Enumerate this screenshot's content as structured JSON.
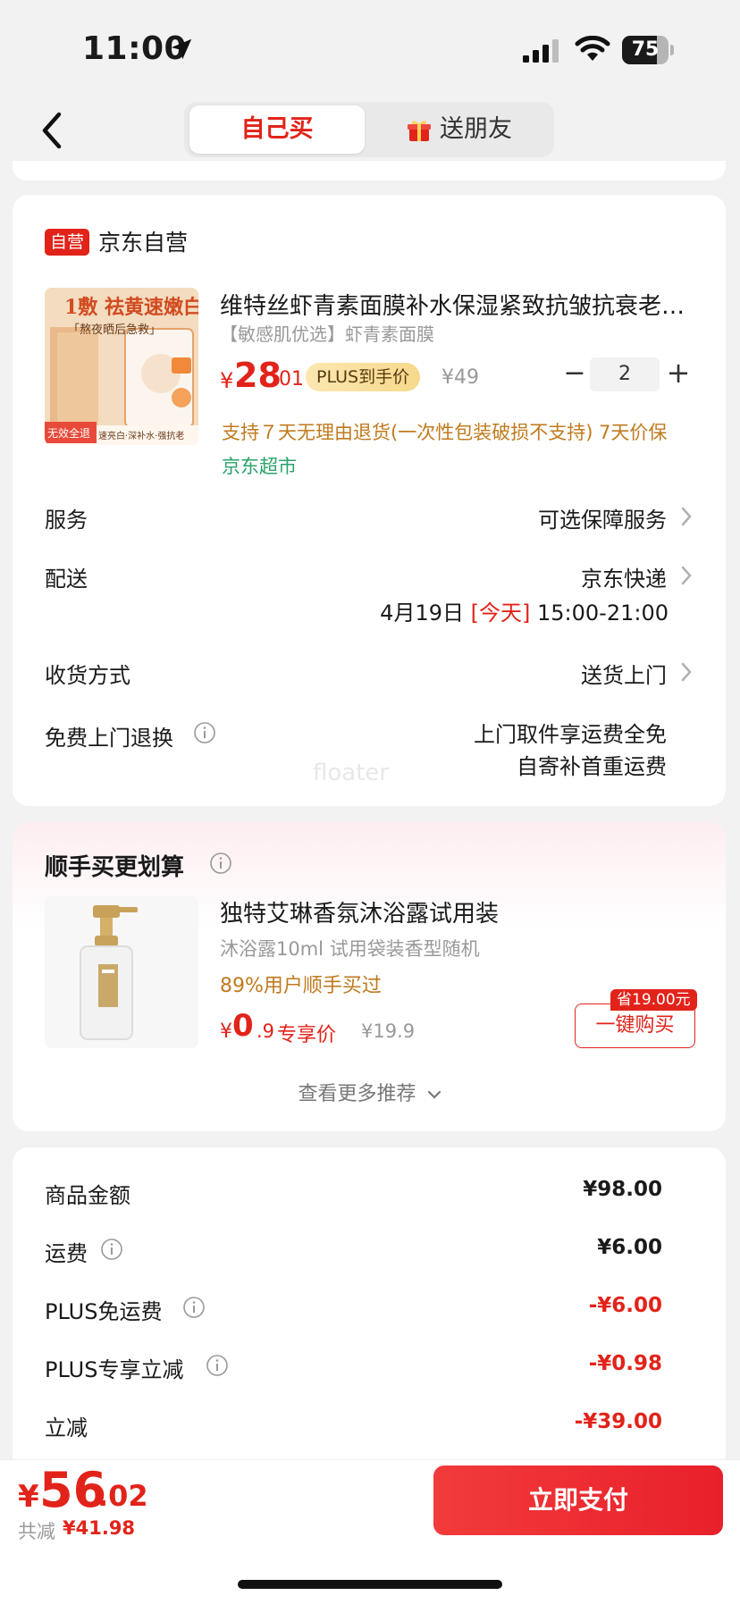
{
  "status_bar": {
    "time": "11:00",
    "battery": "75",
    "battery_level": 0.75
  },
  "header": {
    "tabs": [
      {
        "label": "自己买",
        "active": true
      },
      {
        "label": "送朋友",
        "active": false
      }
    ]
  },
  "store": {
    "badge": "自营",
    "name": "京东自营"
  },
  "product": {
    "title": "维特丝虾青素面膜补水保湿紧致抗皱抗衰老…",
    "subtitle": "【敏感肌优选】虾青素面膜",
    "price_symbol": "¥",
    "price_int": "28",
    "price_dec": ".01",
    "plus_badge": "PLUS到手价",
    "original_price": "¥49",
    "qty_minus": "−",
    "quantity": "2",
    "qty_plus": "+",
    "return_note": "支持７天无理由退货(一次性包装破损不支持)  7天价保",
    "market_tag": "京东超市",
    "image_text": {
      "line1": "1敷 祛黄速嫩白",
      "line2": "「熬夜晒后急救」",
      "bottom": "速亮白·深补水·强抗老",
      "corner": "无效全退"
    }
  },
  "rows": {
    "service": {
      "label": "服务",
      "value": "可选保障服务"
    },
    "delivery": {
      "label": "配送",
      "value": "京东快递",
      "date": "4月19日",
      "today": "[今天]",
      "time": "15:00-21:00"
    },
    "receive": {
      "label": "收货方式",
      "value": "送货上门"
    },
    "free_return": {
      "label": "免费上门退换",
      "line1": "上门取件享运费全免",
      "line2": "自寄补首重运费"
    }
  },
  "watermark": "floater",
  "recommend": {
    "title": "顺手买更划算",
    "name": "独特艾琳香氛沐浴露试用装",
    "subtitle": "沐浴露10ml 试用袋装香型随机",
    "buyers": "89%用户顺手买过",
    "price_symbol": "¥",
    "price_int": "0",
    "price_dec": ".9",
    "price_tag": "专享价",
    "original_price": "¥19.9",
    "save_tag": "省19.00元",
    "buy_button": "一键购买",
    "more": "查看更多推荐"
  },
  "summary": [
    {
      "label": "商品金额",
      "value": "¥98.00",
      "info": false,
      "color": "#1a1a1a"
    },
    {
      "label": "运费",
      "value": "¥6.00",
      "info": true,
      "color": "#1a1a1a"
    },
    {
      "label": "PLUS免运费",
      "value": "-¥6.00",
      "info": true,
      "color": "#e2231a"
    },
    {
      "label": "PLUS专享立减",
      "value": "-¥0.98",
      "info": true,
      "color": "#e2231a"
    },
    {
      "label": "立减",
      "value": "-¥39.00",
      "info": false,
      "color": "#e2231a"
    }
  ],
  "bottom": {
    "price_symbol": "¥",
    "total_int": "56",
    "total_dec": ".02",
    "saved_label": "共减",
    "saved_amount": "¥41.98",
    "pay_button": "立即支付"
  },
  "colors": {
    "accent": "#e2231a",
    "orange": "#c07a1e",
    "green": "#2aa36b"
  },
  "icons": [
    "location-arrow-icon",
    "signal-icon",
    "wifi-icon",
    "battery-icon",
    "back-arrow-icon",
    "gift-icon",
    "chevron-right-icon",
    "info-icon",
    "chevron-down-icon"
  ]
}
